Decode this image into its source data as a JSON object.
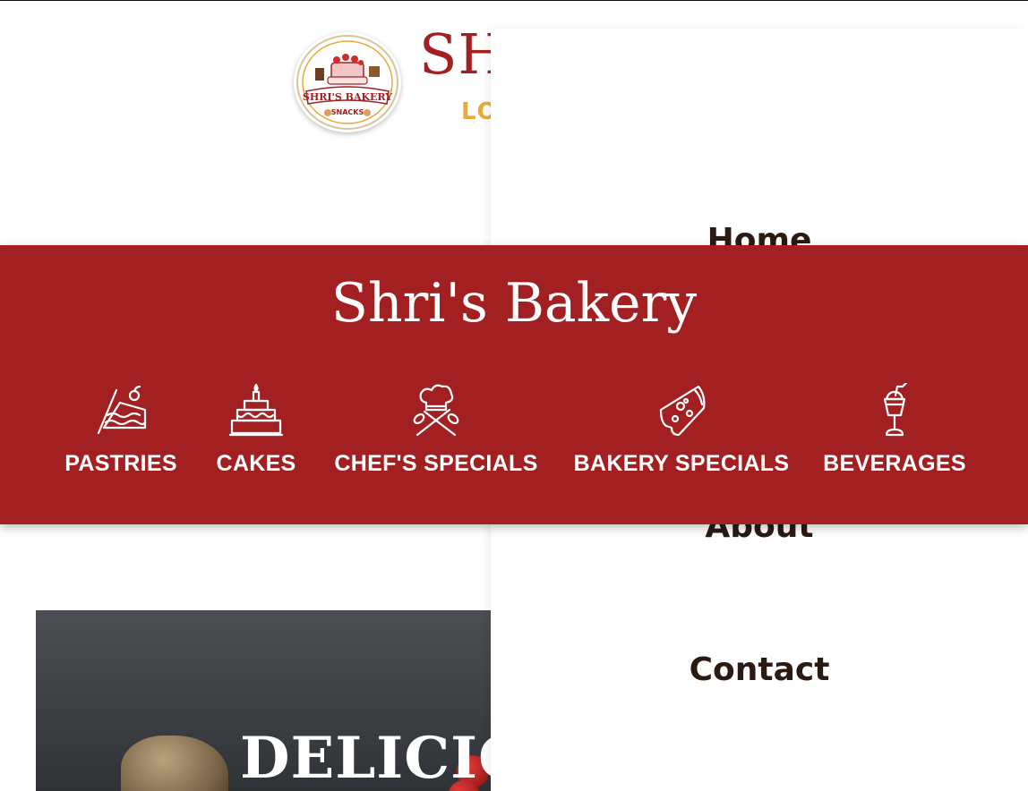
{
  "header": {
    "logo_title": "SHRI'S BAKERY",
    "logo_subtitle": "SNACKS",
    "brand_visible": "SH",
    "tagline_visible": "LO"
  },
  "drawer": {
    "items": [
      {
        "label": "Home"
      },
      {
        "label": "About"
      },
      {
        "label": "Contact"
      }
    ]
  },
  "banner": {
    "title": "Shri's Bakery",
    "categories": [
      {
        "label": "PASTRIES",
        "icon": "cake-slice-icon"
      },
      {
        "label": "CAKES",
        "icon": "birthday-cake-icon"
      },
      {
        "label": "CHEF'S SPECIALS",
        "icon": "chef-hat-icon"
      },
      {
        "label": "BAKERY SPECIALS",
        "icon": "pizza-slice-icon"
      },
      {
        "label": "BEVERAGES",
        "icon": "milkshake-icon"
      }
    ]
  },
  "hero": {
    "title": "DELICIOU"
  },
  "colors": {
    "brand_red": "#a32022",
    "tagline_gold": "#e8a83a",
    "drawer_text": "#2a1a12"
  }
}
